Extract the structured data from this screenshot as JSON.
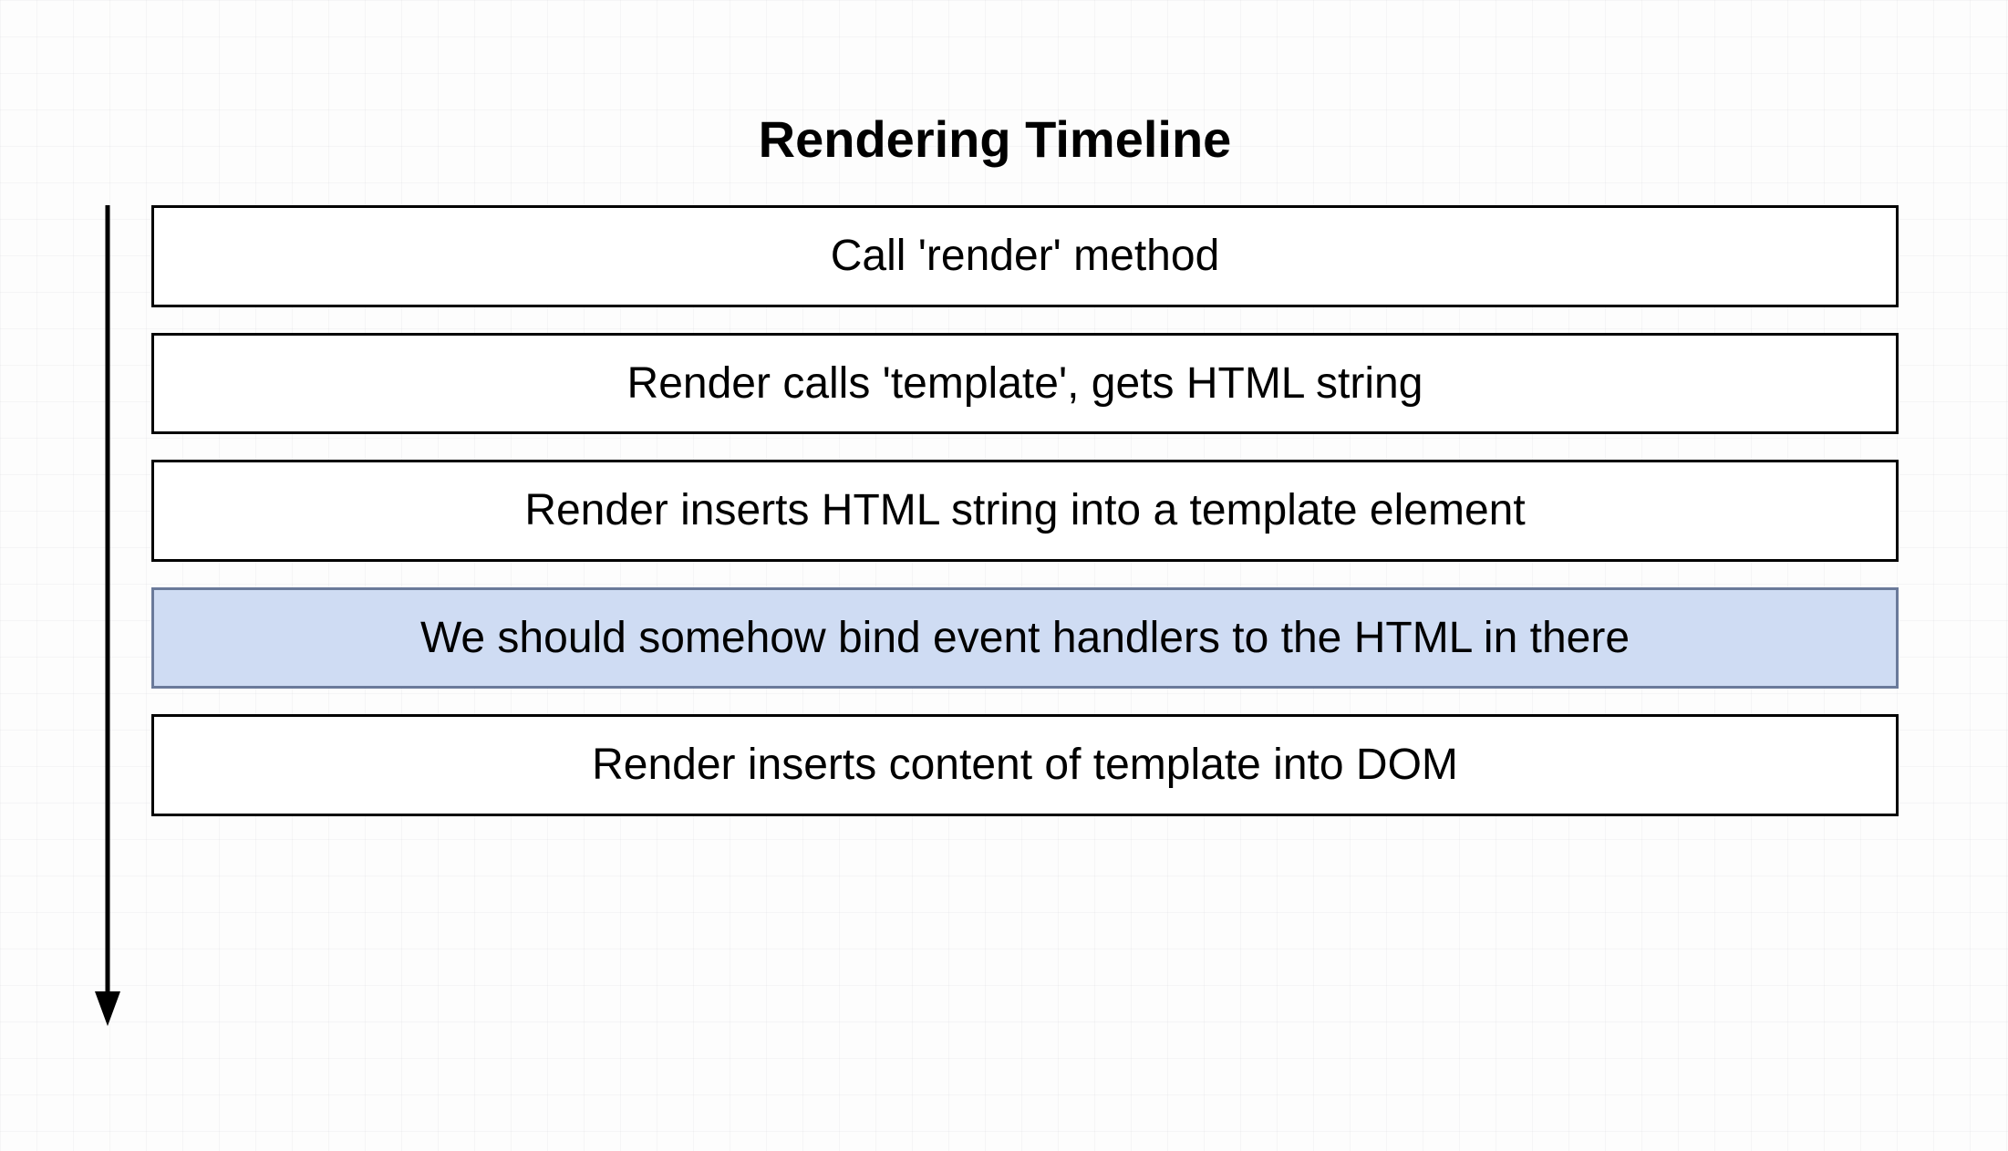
{
  "diagram": {
    "title": "Rendering Timeline",
    "steps": [
      {
        "label": "Call 'render' method",
        "highlighted": false
      },
      {
        "label": "Render calls 'template', gets HTML string",
        "highlighted": false
      },
      {
        "label": "Render inserts HTML string into a template element",
        "highlighted": false
      },
      {
        "label": "We should somehow bind event handlers to the HTML in there",
        "highlighted": true
      },
      {
        "label": "Render inserts content of template into DOM",
        "highlighted": false
      }
    ]
  },
  "colors": {
    "highlight_bg": "#cfdcf3",
    "highlight_border": "#6a7a9a",
    "box_border": "#000000",
    "box_bg": "#ffffff"
  }
}
